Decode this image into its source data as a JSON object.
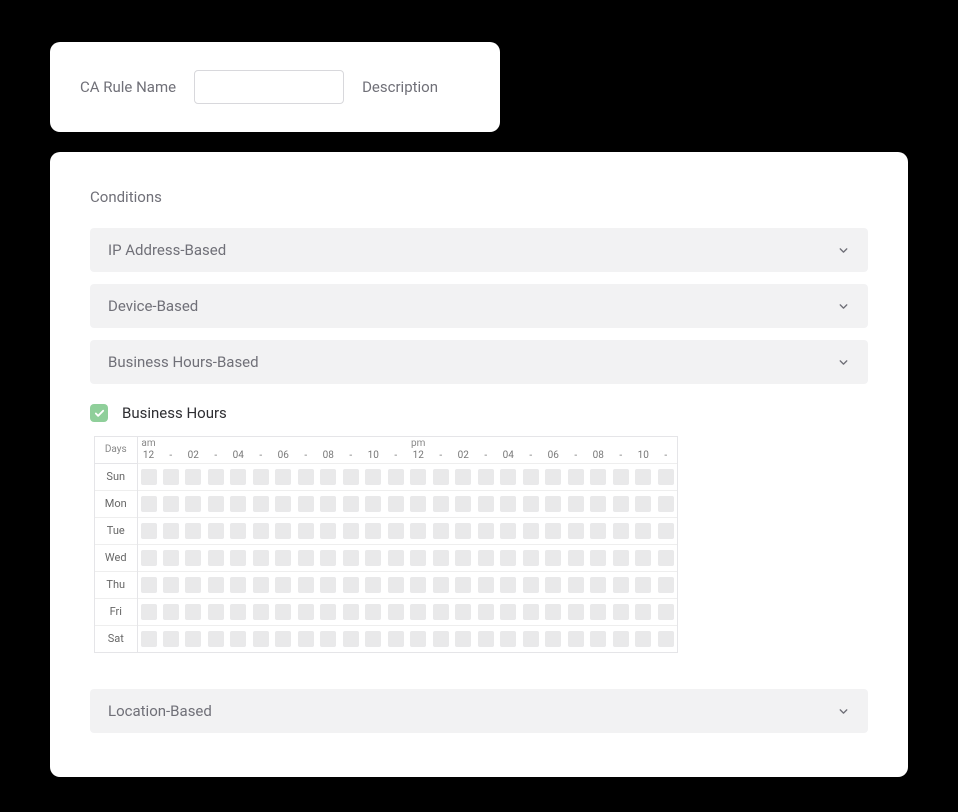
{
  "top": {
    "name_label": "CA Rule Name",
    "name_value": "",
    "desc_label": "Description"
  },
  "conditions": {
    "title": "Conditions",
    "items": [
      {
        "label": "IP Address-Based"
      },
      {
        "label": "Device-Based"
      },
      {
        "label": "Business Hours-Based"
      }
    ],
    "location_label": "Location-Based"
  },
  "business_hours": {
    "checkbox_label": "Business Hours",
    "checked": true,
    "days_header": "Days",
    "am": "am",
    "pm": "pm",
    "hour_labels": [
      "12",
      "-",
      "02",
      "-",
      "04",
      "-",
      "06",
      "-",
      "08",
      "-",
      "10",
      "-",
      "12",
      "-",
      "02",
      "-",
      "04",
      "-",
      "06",
      "-",
      "08",
      "-",
      "10",
      "-"
    ],
    "days": [
      "Sun",
      "Mon",
      "Tue",
      "Wed",
      "Thu",
      "Fri",
      "Sat"
    ]
  }
}
